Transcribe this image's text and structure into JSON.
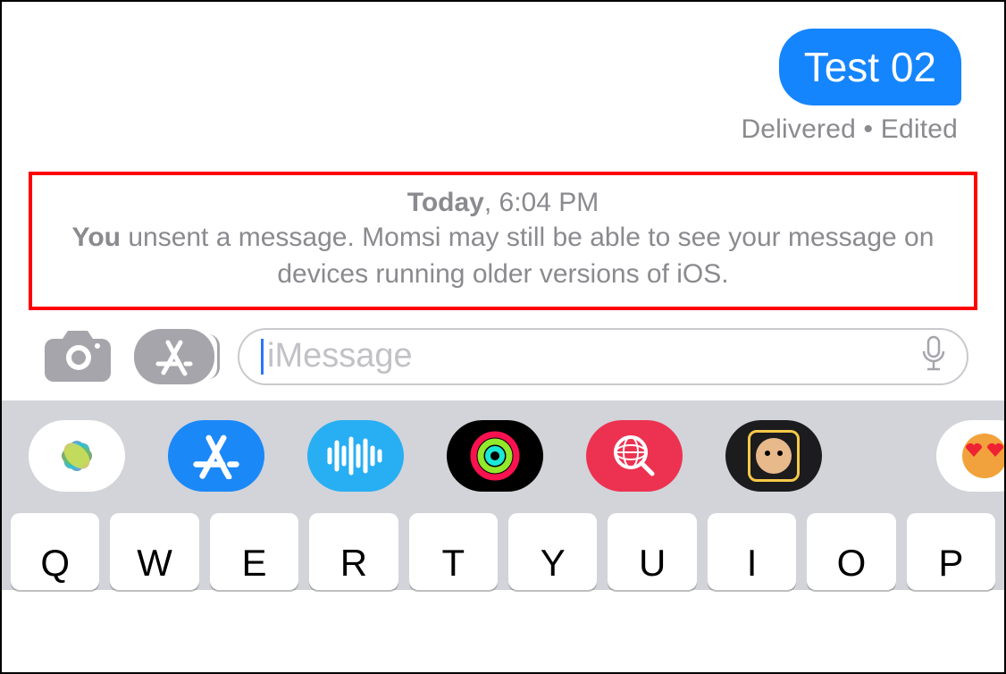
{
  "conversation": {
    "outgoing_message": "Test 02",
    "status": "Delivered • Edited"
  },
  "system_notice": {
    "timestamp_day": "Today",
    "timestamp_time": ", 6:04 PM",
    "unsent_prefix": "You",
    "unsent_body": " unsent a message. Momsi may still be able to see your message on devices running older versions of iOS."
  },
  "compose": {
    "placeholder": "iMessage"
  },
  "app_strip": {
    "items": [
      "photos",
      "appstore",
      "audio",
      "fitness",
      "search",
      "memoji",
      "stickers"
    ]
  },
  "keyboard": {
    "row1": [
      "Q",
      "W",
      "E",
      "R",
      "T",
      "Y",
      "U",
      "I",
      "O",
      "P"
    ]
  },
  "colors": {
    "bubble_blue": "#1585fe",
    "annotation_red": "#ff0000",
    "gray_text": "#8a8a8f"
  }
}
